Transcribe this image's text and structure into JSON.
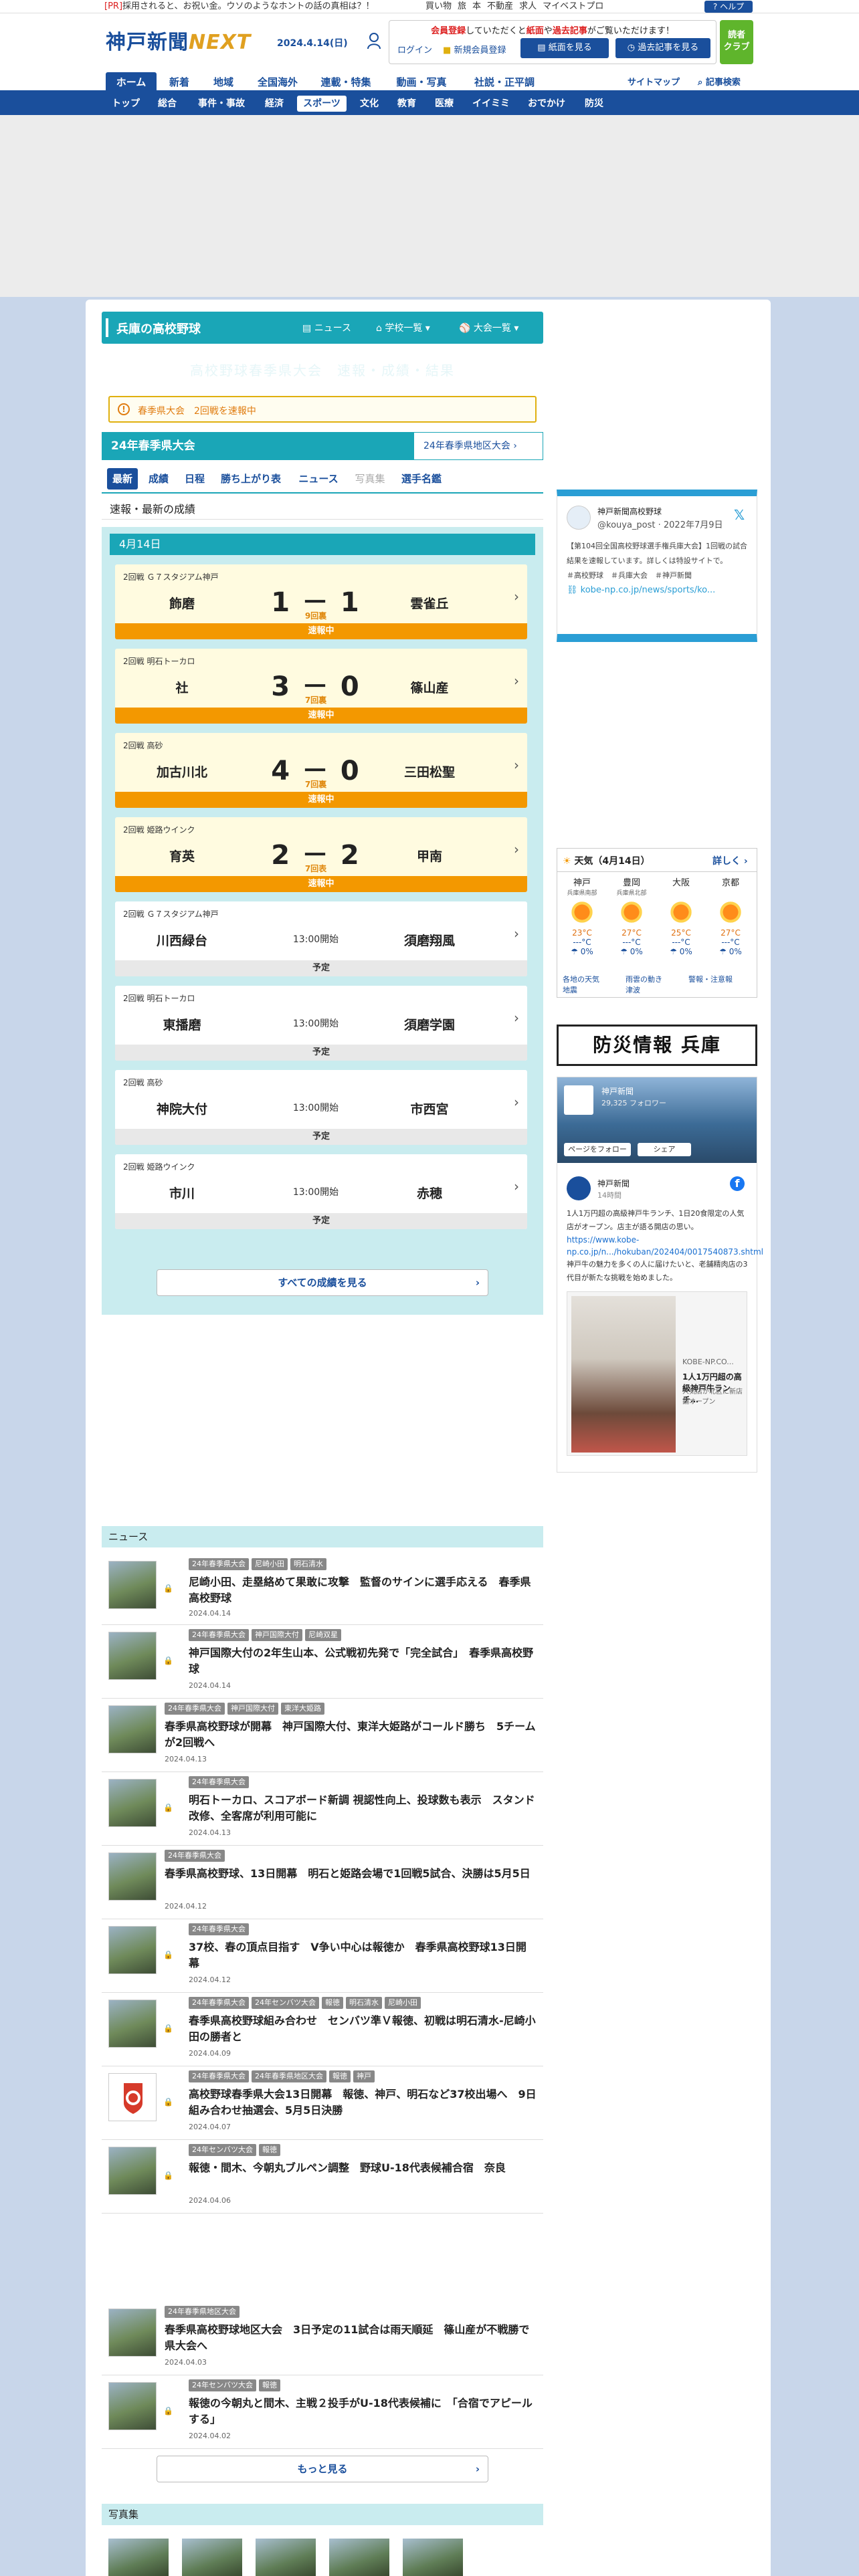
{
  "top": {
    "pr_tag": "[PR]",
    "pr_text": "採用されると、お祝い金。ウソのようなホントの話の真相は？！",
    "links": [
      "買い物",
      "旅",
      "本",
      "不動産",
      "求人",
      "マイベストプロ"
    ],
    "help": "ヘルプ"
  },
  "header": {
    "logo_main": "神戸新聞",
    "logo_next": "NEXT",
    "date": "2024.4.14(日)",
    "member_msg_pre": "会員登録",
    "member_msg_mid": "していただくと",
    "member_msg_b1": "紙面",
    "member_msg_and": "や",
    "member_msg_b2": "過去記事",
    "member_msg_post": "がご覧いただけます！",
    "login": "ログイン",
    "register": "新規会員登録",
    "paper_btn": "紙面を見る",
    "past_btn": "過去記事を見る",
    "club_l1": "読者",
    "club_l2": "クラブ"
  },
  "mainnav": {
    "items": [
      "ホーム",
      "新着",
      "地域",
      "全国海外",
      "連載・特集",
      "動画・写真",
      "社説・正平調"
    ],
    "sitemap": "サイトマップ",
    "search": "記事検索"
  },
  "subnav": {
    "items": [
      "トップ",
      "総合",
      "事件・事故",
      "経済",
      "スポーツ",
      "文化",
      "教育",
      "医療",
      "イイミミ",
      "おでかけ",
      "防災"
    ]
  },
  "section": {
    "title": "兵庫の高校野球",
    "link_news": "ニュース",
    "link_schools": "学校一覧",
    "link_tournaments": "大会一覧",
    "headline": "高校野球春季県大会　速報・成績・結果"
  },
  "alert": {
    "text": "春季県大会　2回戦を速報中"
  },
  "tournament": {
    "name": "24年春季県大会",
    "other": "24年春季県地区大会"
  },
  "tabs": [
    "最新",
    "成績",
    "日程",
    "勝ち上がり表",
    "ニュース",
    "写真集",
    "選手名鑑"
  ],
  "section_sub": "速報・最新の成績",
  "scoreboard": {
    "date": "4月14日",
    "games": [
      {
        "info": "2回戦 Ｇ７スタジアム神戸",
        "home": "飾磨",
        "away": "雲雀丘",
        "score": "1 － 1",
        "inning": "9回裏",
        "status": "速報中"
      },
      {
        "info": "2回戦 明石トーカロ",
        "home": "社",
        "away": "篠山産",
        "score": "3 － 0",
        "inning": "7回裏",
        "status": "速報中"
      },
      {
        "info": "2回戦 高砂",
        "home": "加古川北",
        "away": "三田松聖",
        "score": "4 － 0",
        "inning": "7回裏",
        "status": "速報中"
      },
      {
        "info": "2回戦 姫路ウインク",
        "home": "育英",
        "away": "甲南",
        "score": "2 － 2",
        "inning": "7回表",
        "status": "速報中"
      },
      {
        "info": "2回戦 Ｇ７スタジアム神戸",
        "home": "川西緑台",
        "away": "須磨翔風",
        "start": "13:00開始",
        "status": "予定"
      },
      {
        "info": "2回戦 明石トーカロ",
        "home": "東播磨",
        "away": "須磨学園",
        "start": "13:00開始",
        "status": "予定"
      },
      {
        "info": "2回戦 高砂",
        "home": "神院大付",
        "away": "市西宮",
        "start": "13:00開始",
        "status": "予定"
      },
      {
        "info": "2回戦 姫路ウインク",
        "home": "市川",
        "away": "赤穂",
        "start": "13:00開始",
        "status": "予定"
      }
    ],
    "all_results": "すべての成績を見る"
  },
  "xwidget": {
    "name": "神戸新聞高校野球",
    "handle": "@kouya_post · 2022年7月9日",
    "body": "【第104回全国高校野球選手権兵庫大会】1回戦の試合結果を速報しています。詳しくは特設サイトで。",
    "body2": "＃高校野球　＃兵庫大会　＃神戸新聞",
    "link": "kobe-np.co.jp/news/sports/ko..."
  },
  "weather": {
    "title": "天気（4月14日）",
    "detail": "詳しく",
    "cities": [
      {
        "name": "神戸",
        "sub": "兵庫県南部",
        "temp": "23°C",
        "temp2": "---°C",
        "rain": "0%"
      },
      {
        "name": "豊岡",
        "sub": "兵庫県北部",
        "temp": "27°C",
        "temp2": "---°C",
        "rain": "0%"
      },
      {
        "name": "大阪",
        "sub": "",
        "temp": "25°C",
        "temp2": "---°C",
        "rain": "0%"
      },
      {
        "name": "京都",
        "sub": "",
        "temp": "27°C",
        "temp2": "---°C",
        "rain": "0%"
      }
    ],
    "links": [
      "各地の天気",
      "雨雲の動き",
      "警報・注意報",
      "地震",
      "津波"
    ]
  },
  "bousai": "防災情報 兵庫",
  "fb": {
    "page": "神戸新聞",
    "followers": "29,325 フォロワー",
    "follow_btn": "ページをフォロー",
    "share_btn": "シェア",
    "poster": "神戸新聞",
    "time": "14時間",
    "text": "1人1万円超の高級神戸牛ランチ、1日20食限定の人気店がオープン。店主が語る開店の思い。",
    "url": "https://www.kobe-np.co.jp/n.../hokuban/202404/0017540873.shtml",
    "text2": "神戸牛の魅力を多くの人に届けたいと、老舗精肉店の3代目が新たな挑戦を始めました。",
    "cap_site": "KOBE-NP.CO...",
    "cap_title": "1人1万円超の高級神戸牛ランチ…",
    "cap_desc": "人気店が北区に新店舗オープン"
  },
  "news": {
    "title": "ニュース",
    "items": [
      {
        "tags": [
          "24年春季県大会",
          "尼崎小田",
          "明石清水"
        ],
        "title": "尼崎小田、走塁絡めて果敢に攻撃　監督のサインに選手応える　春季県高校野球",
        "date": "2024.04.14",
        "lock": true
      },
      {
        "tags": [
          "24年春季県大会",
          "神戸国際大付",
          "尼崎双星"
        ],
        "title": "神戸国際大付の2年生山本、公式戦初先発で「完全試合」　春季県高校野球",
        "date": "2024.04.14",
        "lock": true
      },
      {
        "tags": [
          "24年春季県大会",
          "神戸国際大付",
          "東洋大姫路"
        ],
        "title": "春季県高校野球が開幕　神戸国際大付、東洋大姫路がコールド勝ち　5チームが2回戦へ",
        "date": "2024.04.13",
        "lock": false
      },
      {
        "tags": [
          "24年春季県大会"
        ],
        "title": "明石トーカロ、スコアボード新調 視認性向上、投球数も表示　スタンド改修、全客席が利用可能に",
        "date": "2024.04.13",
        "lock": true
      },
      {
        "tags": [
          "24年春季県大会"
        ],
        "title": "春季県高校野球、13日開幕　明石と姫路会場で1回戦5試合、決勝は5月5日",
        "date": "2024.04.12",
        "lock": false
      },
      {
        "tags": [
          "24年春季県大会"
        ],
        "title": "37校、春の頂点目指す　V争い中心は報徳か　春季県高校野球13日開幕",
        "date": "2024.04.12",
        "lock": true
      },
      {
        "tags": [
          "24年春季県大会",
          "24年センバツ大会",
          "報徳",
          "明石清水",
          "尼崎小田"
        ],
        "title": "春季県高校野球組み合わせ　センバツ準Ｖ報徳、初戦は明石清水-尼崎小田の勝者と",
        "date": "2024.04.09",
        "lock": true
      },
      {
        "tags": [
          "24年春季県大会",
          "24年春季県地区大会",
          "報徳",
          "神戸"
        ],
        "title": "高校野球春季県大会13日開幕　報徳、神戸、明石など37校出場へ　9日組み合わせ抽選会、5月5日決勝",
        "date": "2024.04.07",
        "lock": true
      },
      {
        "tags": [
          "24年センバツ大会",
          "報徳"
        ],
        "title": "報徳・間木、今朝丸ブルペン調整　野球U-18代表候補合宿　奈良",
        "date": "2024.04.06",
        "lock": true
      },
      {
        "tags": [
          "24年春季県地区大会"
        ],
        "title": "春季県高校野球地区大会　3日予定の11試合は雨天順延　篠山産が不戦勝で県大会へ",
        "date": "2024.04.03",
        "lock": false
      },
      {
        "tags": [
          "24年センバツ大会",
          "報徳"
        ],
        "title": "報徳の今朝丸と間木、主戦２投手がU-18代表候補に　「合宿でアピールする」",
        "date": "2024.04.02",
        "lock": true
      }
    ],
    "more": "もっと見る"
  },
  "photos": {
    "title": "写真集"
  }
}
